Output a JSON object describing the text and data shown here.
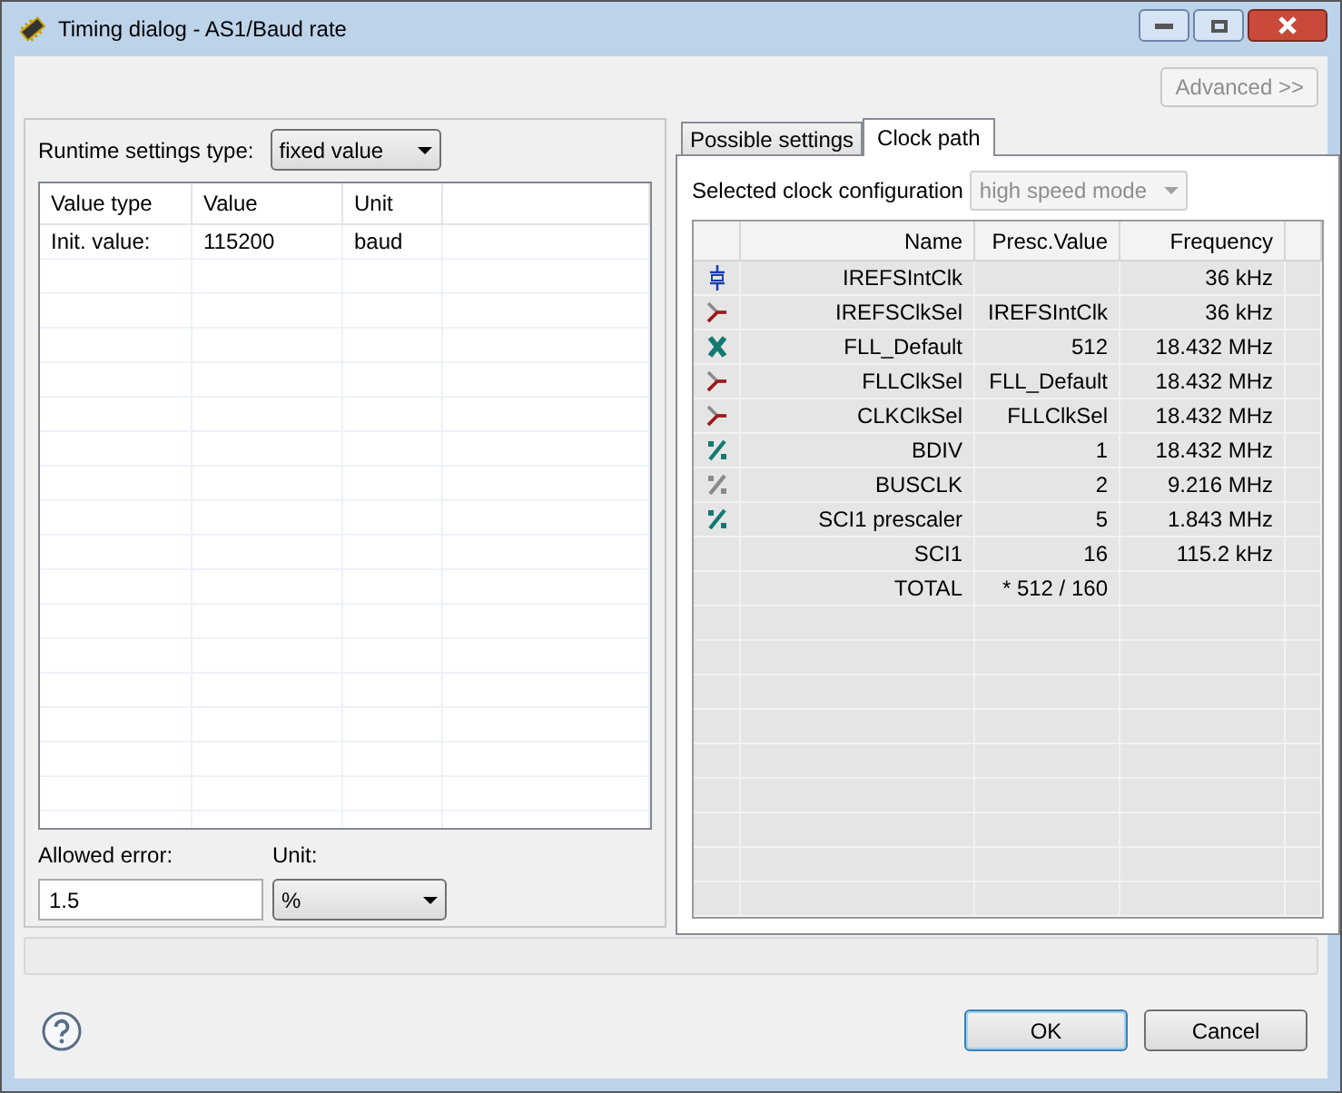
{
  "window": {
    "title": "Timing dialog - AS1/Baud rate"
  },
  "advanced_button": {
    "label": "Advanced >>",
    "disabled": true
  },
  "runtime": {
    "label": "Runtime settings type:",
    "value": "fixed value"
  },
  "values_table": {
    "columns": [
      "Value type",
      "Value",
      "Unit"
    ],
    "rows": [
      [
        "Init. value:",
        "115200",
        "baud"
      ]
    ]
  },
  "allowed_error": {
    "label": "Allowed error:",
    "value": "1.5"
  },
  "unit": {
    "label": "Unit:",
    "value": "%"
  },
  "tabs": [
    {
      "label": "Possible settings",
      "selected": false
    },
    {
      "label": "Clock path",
      "selected": true
    }
  ],
  "clock_config": {
    "label": "Selected clock configuration",
    "value": "high speed mode",
    "disabled": true
  },
  "clock_table": {
    "columns": [
      "Name",
      "Presc.Value",
      "Frequency"
    ],
    "rows": [
      {
        "kind": "oscillator",
        "name": "IREFSIntClk",
        "presc": "",
        "frequency": "36 kHz"
      },
      {
        "kind": "mux",
        "name": "IREFSClkSel",
        "presc": "IREFSIntClk",
        "frequency": "36 kHz"
      },
      {
        "kind": "multiplier",
        "name": "FLL_Default",
        "presc": "512",
        "frequency": "18.432 MHz"
      },
      {
        "kind": "mux",
        "name": "FLLClkSel",
        "presc": "FLL_Default",
        "frequency": "18.432 MHz"
      },
      {
        "kind": "mux",
        "name": "CLKClkSel",
        "presc": "FLLClkSel",
        "frequency": "18.432 MHz"
      },
      {
        "kind": "divider",
        "name": "BDIV",
        "presc": "1",
        "frequency": "18.432 MHz"
      },
      {
        "kind": "divider_fixed",
        "name": "BUSCLK",
        "presc": "2",
        "frequency": "9.216 MHz"
      },
      {
        "kind": "divider",
        "name": "SCI1 prescaler",
        "presc": "5",
        "frequency": "1.843 MHz"
      },
      {
        "kind": "none",
        "name": "SCI1",
        "presc": "16",
        "frequency": "115.2 kHz"
      },
      {
        "kind": "none",
        "name": "TOTAL",
        "presc": "* 512 / 160",
        "frequency": ""
      }
    ]
  },
  "buttons": [
    {
      "label": "OK",
      "default": true
    },
    {
      "label": "Cancel",
      "default": false
    }
  ]
}
